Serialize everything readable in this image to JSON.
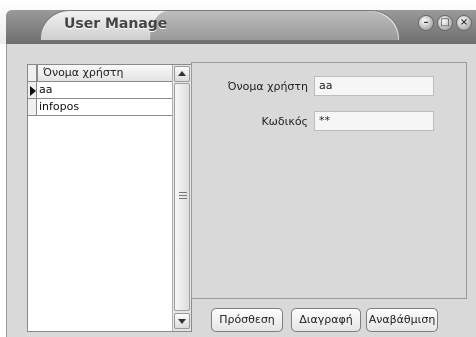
{
  "window": {
    "title": "User Manage",
    "controls": {
      "minimize": "–",
      "maximize": "□",
      "close": "×"
    }
  },
  "grid": {
    "column_header": "Όνομα χρήστη",
    "rows": [
      "aa",
      "infopos"
    ],
    "selected_row": 0
  },
  "form": {
    "username_label": "Όνομα χρήστη",
    "username_value": "aa",
    "password_label": "Κωδικός",
    "password_value": "**"
  },
  "buttons": {
    "add": "Πρόσθεση",
    "delete": "Διαγραφή",
    "update": "Αναβάθμιση"
  },
  "icons": {
    "row_selector": "row-pointer-icon",
    "scroll_up": "arrow-up-icon",
    "scroll_down": "arrow-down-icon",
    "grip": "scroll-grip-icon"
  }
}
